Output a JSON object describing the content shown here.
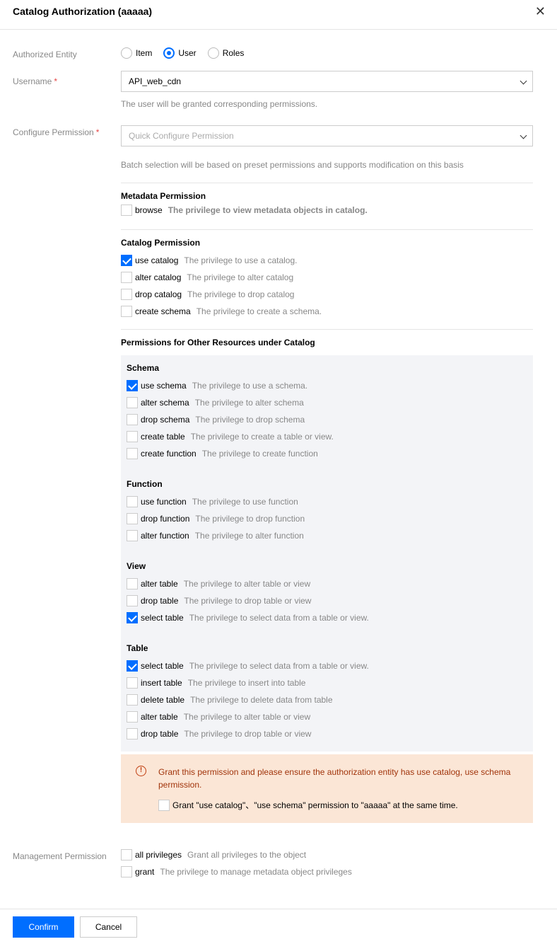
{
  "dialog": {
    "title": "Catalog Authorization (aaaaa)",
    "close_glyph": "✕"
  },
  "entity": {
    "label": "Authorized Entity",
    "options": [
      {
        "label": "Item",
        "selected": false
      },
      {
        "label": "User",
        "selected": true
      },
      {
        "label": "Roles",
        "selected": false
      }
    ]
  },
  "username": {
    "label": "Username",
    "required_mark": "*",
    "value": "API_web_cdn",
    "hint": "The user will be granted corresponding permissions."
  },
  "configure": {
    "label": "Configure Permission",
    "required_mark": "*",
    "placeholder": "Quick Configure Permission",
    "hint": "Batch selection will be based on preset permissions and supports modification on this basis"
  },
  "metadata": {
    "title": "Metadata Permission",
    "items": [
      {
        "name": "browse",
        "desc": "The privilege to view metadata objects in catalog.",
        "checked": false
      }
    ]
  },
  "catalog": {
    "title": "Catalog Permission",
    "items": [
      {
        "name": "use catalog",
        "desc": "The privilege to use a catalog.",
        "checked": true
      },
      {
        "name": "alter catalog",
        "desc": "The privilege to alter catalog",
        "checked": false
      },
      {
        "name": "drop catalog",
        "desc": "The privilege to drop catalog",
        "checked": false
      },
      {
        "name": "create schema",
        "desc": "The privilege to create a schema.",
        "checked": false
      }
    ]
  },
  "other": {
    "title": "Permissions for Other Resources under Catalog",
    "schema": {
      "title": "Schema",
      "items": [
        {
          "name": "use schema",
          "desc": "The privilege to use a schema.",
          "checked": true
        },
        {
          "name": "alter schema",
          "desc": "The privilege to alter schema",
          "checked": false
        },
        {
          "name": "drop schema",
          "desc": "The privilege to drop schema",
          "checked": false
        },
        {
          "name": "create table",
          "desc": "The privilege to create a table or view.",
          "checked": false
        },
        {
          "name": "create function",
          "desc": "The privilege to create function",
          "checked": false
        }
      ]
    },
    "function": {
      "title": "Function",
      "items": [
        {
          "name": "use function",
          "desc": "The privilege to use function",
          "checked": false
        },
        {
          "name": "drop function",
          "desc": "The privilege to drop function",
          "checked": false
        },
        {
          "name": "alter function",
          "desc": "The privilege to alter function",
          "checked": false
        }
      ]
    },
    "view": {
      "title": "View",
      "items": [
        {
          "name": "alter table",
          "desc": "The privilege to alter table or view",
          "checked": false
        },
        {
          "name": "drop table",
          "desc": "The privilege to drop table or view",
          "checked": false
        },
        {
          "name": "select table",
          "desc": "The privilege to select data from a table or view.",
          "checked": true
        }
      ]
    },
    "table": {
      "title": "Table",
      "items": [
        {
          "name": "select table",
          "desc": "The privilege to select data from a table or view.",
          "checked": true
        },
        {
          "name": "insert table",
          "desc": "The privilege to insert into table",
          "checked": false
        },
        {
          "name": "delete table",
          "desc": "The privilege to delete data from table",
          "checked": false
        },
        {
          "name": "alter table",
          "desc": "The privilege to alter table or view",
          "checked": false
        },
        {
          "name": "drop table",
          "desc": "The privilege to drop table or view",
          "checked": false
        }
      ]
    }
  },
  "warning": {
    "icon": "!",
    "text": "Grant this permission and please ensure the authorization entity has use catalog, use schema permission.",
    "checkbox_label": "Grant \"use catalog\"、\"use schema\" permission to \"aaaaa\" at the same time.",
    "checked": false
  },
  "management": {
    "label": "Management Permission",
    "items": [
      {
        "name": "all privileges",
        "desc": "Grant all privileges to the object",
        "checked": false
      },
      {
        "name": "grant",
        "desc": "The privilege to manage metadata object privileges",
        "checked": false
      }
    ]
  },
  "footer": {
    "confirm": "Confirm",
    "cancel": "Cancel"
  },
  "colors": {
    "primary": "#006eff",
    "warning_bg": "#fbe6d6",
    "warning_text": "#a1340b",
    "panel_bg": "#f3f4f7"
  }
}
